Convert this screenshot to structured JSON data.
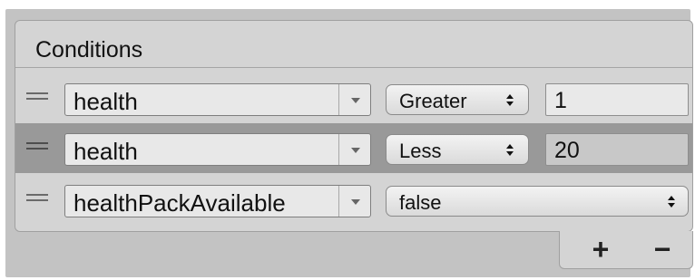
{
  "conditions": {
    "title": "Conditions",
    "rows": [
      {
        "parameter": "health",
        "operator": "Greater",
        "value": "1"
      },
      {
        "parameter": "health",
        "operator": "Less",
        "value": "20"
      },
      {
        "parameter": "healthPackAvailable",
        "bool_value": "false"
      }
    ]
  },
  "footer": {
    "add_label": "+",
    "remove_label": "−"
  }
}
